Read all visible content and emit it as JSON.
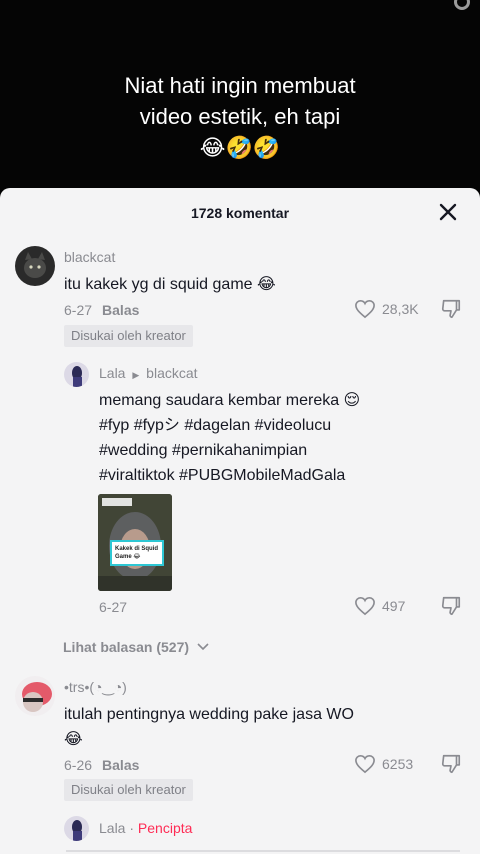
{
  "video": {
    "caption_line1": "Niat hati ingin membuat",
    "caption_line2": "video estetik, eh tapi",
    "caption_emojis": "😂🤣🤣"
  },
  "comments_panel": {
    "title": "1728 komentar",
    "close_icon": "close-icon"
  },
  "comment1": {
    "username": "blackcat",
    "text": "itu kakek yg di squid game 😂",
    "date": "6-27",
    "reply_label": "Balas",
    "likes": "28,3K",
    "badge": "Disukai oleh kreator"
  },
  "reply1": {
    "username": "Lala",
    "reply_to": "blackcat",
    "text_line1": "memang saudara kembar mereka 😌",
    "text_line2": "#fyp #fypシ #dagelan #videolucu",
    "text_line3": "#wedding #pernikahanimpian",
    "text_line4": "#viraltiktok #PUBGMobileMadGala",
    "thumb_sticker": "Kakek di Squid Game 😂",
    "date": "6-27",
    "likes": "497"
  },
  "view_replies": "Lihat balasan (527)",
  "comment2": {
    "username": "•trs•(◔‿◔)",
    "text_line1": "itulah pentingnya wedding pake jasa WO",
    "text_line2": "😂",
    "date": "6-26",
    "reply_label": "Balas",
    "likes": "6253",
    "badge": "Disukai oleh kreator"
  },
  "reply2": {
    "username": "Lala",
    "role": "Pencipta"
  },
  "colors": {
    "accent": "#fe2c55",
    "sheet_bg": "#f4f4f5",
    "muted": "#8a8b91"
  }
}
